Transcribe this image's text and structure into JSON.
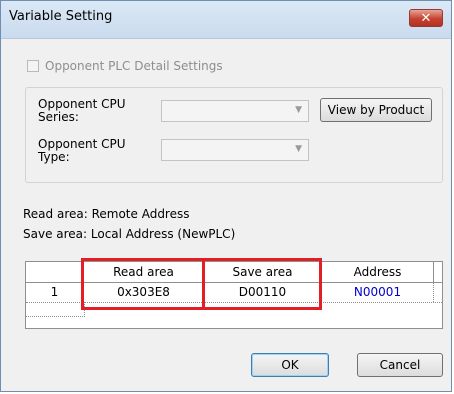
{
  "window": {
    "title": "Variable Setting",
    "close_glyph": "✕"
  },
  "opponent_detail": {
    "label": "Opponent PLC Detail Settings",
    "checked": false,
    "enabled": false
  },
  "cpu_group": {
    "series_label_1": "Opponent CPU",
    "series_label_2": "Series:",
    "type_label_1": "Opponent CPU",
    "type_label_2": "Type:",
    "series_value": "",
    "type_value": "",
    "view_button_label": "View by Product"
  },
  "info": {
    "read_line": "Read area: Remote Address",
    "save_line": "Save area: Local Address (NewPLC)"
  },
  "grid": {
    "columns": [
      "",
      "Read area",
      "Save area",
      "Address"
    ],
    "rows": [
      {
        "index": "1",
        "read": "0x303E8",
        "save": "D00110",
        "address": "N00001"
      }
    ],
    "address_color": "#0000cc",
    "highlight_color": "#e31e24"
  },
  "buttons": {
    "ok_label": "OK",
    "cancel_label": "Cancel"
  },
  "icons": {
    "combo_arrow": "▼"
  }
}
